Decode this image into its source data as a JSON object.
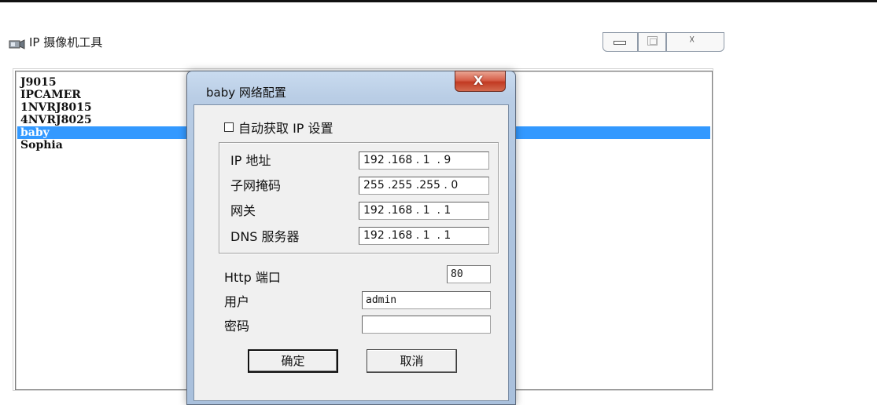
{
  "window": {
    "title": "IP 摄像机工具",
    "icon": "camera-icon",
    "controls": [
      "minimize",
      "maximize",
      "close"
    ]
  },
  "device_list": {
    "items": [
      "J9015",
      "IPCAMER",
      "1NVRJ8015",
      "4NVRJ8025",
      "baby",
      "Sophia"
    ],
    "selected": "baby",
    "selection_color": "#3399ff"
  },
  "dialog": {
    "title": "baby 网络配置",
    "close_glyph": "X",
    "auto_ip_label": "自动获取 IP 设置",
    "auto_ip_checked": false,
    "fields": {
      "ip": {
        "label": "IP 地址",
        "value": "192 .168 . 1  . 9"
      },
      "mask": {
        "label": "子网掩码",
        "value": "255 .255 .255 . 0"
      },
      "gateway": {
        "label": "网关",
        "value": "192 .168 . 1  . 1"
      },
      "dns": {
        "label": "DNS 服务器",
        "value": "192 .168 . 1  . 1"
      }
    },
    "http_port": {
      "label": "Http 端口",
      "value": "80"
    },
    "user": {
      "label": "用户",
      "value": "admin"
    },
    "password": {
      "label": "密码",
      "value": ""
    },
    "ok_label": "确定",
    "cancel_label": "取消"
  }
}
